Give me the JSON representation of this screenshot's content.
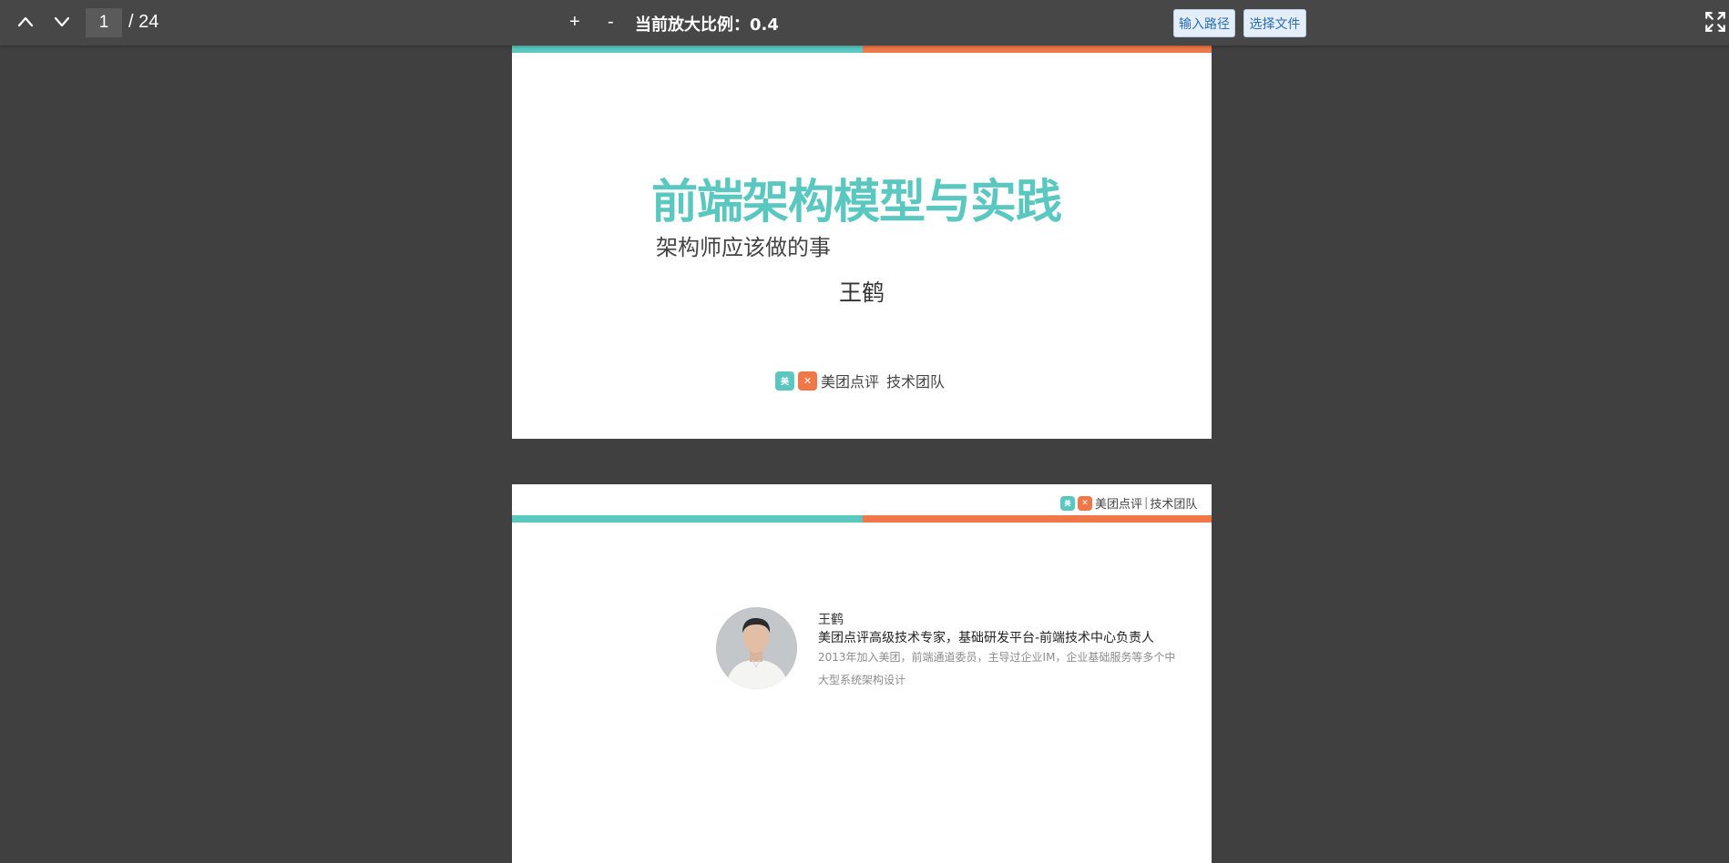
{
  "toolbar": {
    "current_page": "1",
    "total_pages": "/ 24",
    "zoom_in_label": "+",
    "zoom_out_label": "-",
    "zoom_text": "当前放大比例：0.4",
    "input_path_label": "输入路径",
    "choose_file_label": "选择文件"
  },
  "slides": [
    {
      "title": "前端架构模型与实践",
      "subtitle": "架构师应该做的事",
      "author": "王鹤",
      "logo_text": "美团点评",
      "team_text": "技术团队"
    },
    {
      "logo_text": "美团点评",
      "team_text": "技术团队",
      "name": "王鹤",
      "role": "美团点评高级技术专家，基础研发平台-前端技术中心负责人",
      "bio": "2013年加入美团，前端通道委员，主导过企业IM，企业基础服务等多个中大型系统架构设计"
    }
  ],
  "colors": {
    "toolbar_bg": "#474747",
    "viewer_bg": "#404040",
    "teal": "#5ac7c0",
    "orange": "#ef7748"
  },
  "icons": [
    "chevron-up-icon",
    "chevron-down-icon",
    "fullscreen-icon",
    "meituan-logo-icon",
    "dianping-logo-icon"
  ]
}
